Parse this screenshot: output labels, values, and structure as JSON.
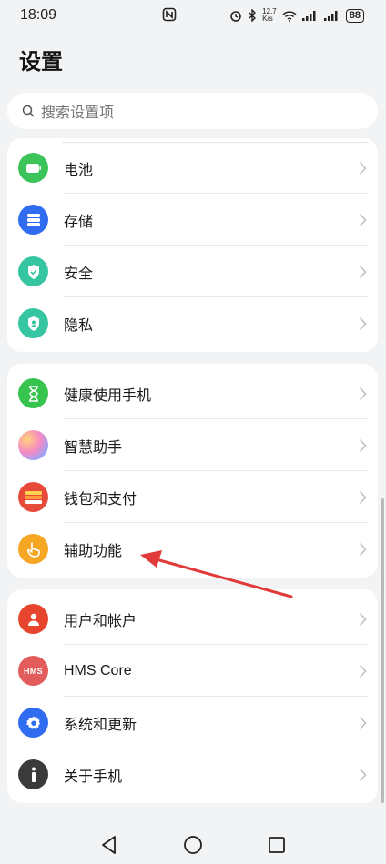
{
  "status": {
    "time": "18:09",
    "speed_value": "12.7",
    "speed_unit": "K/s",
    "battery": "88"
  },
  "title": "设置",
  "search": {
    "placeholder": "搜索设置项"
  },
  "groups": [
    {
      "items": [
        {
          "label": "电池",
          "icon": "battery-icon",
          "color": "#3cc45a"
        },
        {
          "label": "存储",
          "icon": "storage-icon",
          "color": "#2f6cf0"
        },
        {
          "label": "安全",
          "icon": "shield-check-icon",
          "color": "#35c5a0"
        },
        {
          "label": "隐私",
          "icon": "privacy-shield-icon",
          "color": "#35c5a0"
        }
      ]
    },
    {
      "items": [
        {
          "label": "健康使用手机",
          "icon": "hourglass-icon",
          "color": "#36c44f"
        },
        {
          "label": "智慧助手",
          "icon": "smart-assistant-icon",
          "color": "#b98cf5"
        },
        {
          "label": "钱包和支付",
          "icon": "wallet-icon",
          "color": "#e84a3a"
        },
        {
          "label": "辅助功能",
          "icon": "hand-pointer-icon",
          "color": "#f5a623"
        }
      ]
    },
    {
      "items": [
        {
          "label": "用户和帐户",
          "icon": "user-icon",
          "color": "#e8452f"
        },
        {
          "label": "HMS Core",
          "icon": "hms-icon",
          "color": "#e25c5c",
          "icon_text": "HMS"
        },
        {
          "label": "系统和更新",
          "icon": "gear-icon",
          "color": "#2f6cf0"
        },
        {
          "label": "关于手机",
          "icon": "info-icon",
          "color": "#3a3a3a"
        }
      ]
    }
  ],
  "colors": {
    "background": "#f1f3f5",
    "arrow": "#e03a3a"
  }
}
